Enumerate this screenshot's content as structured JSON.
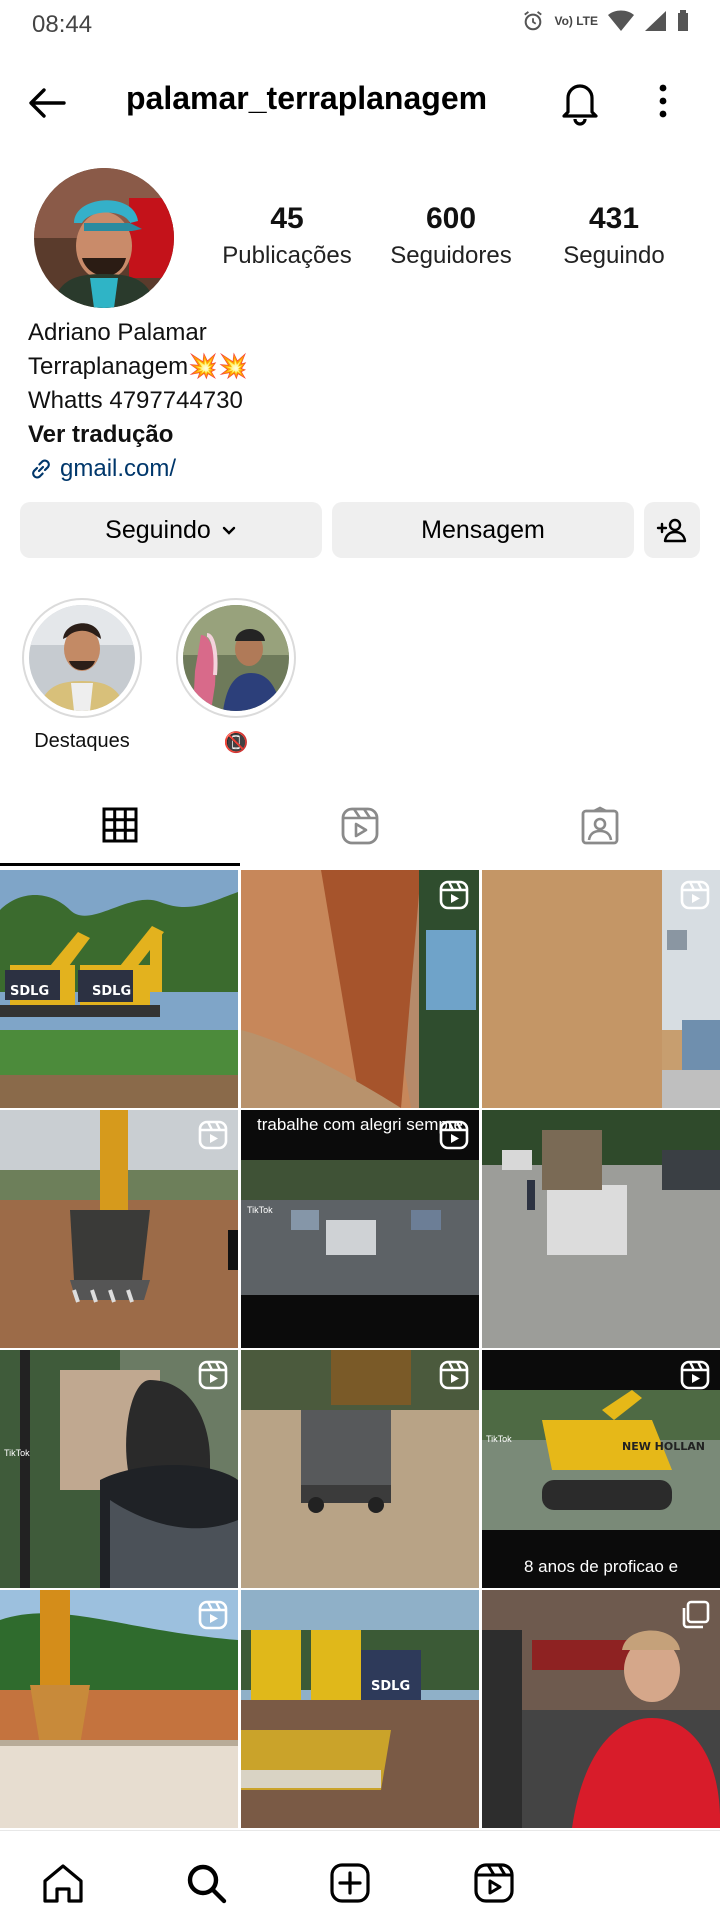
{
  "status": {
    "time": "08:44",
    "network_label": "Vo) LTE"
  },
  "header": {
    "username": "palamar_terraplanagem",
    "icons": [
      "back-arrow-icon",
      "bell-icon",
      "more-vertical-icon"
    ]
  },
  "profile": {
    "stats": [
      {
        "value": "45",
        "label": "Publicações"
      },
      {
        "value": "600",
        "label": "Seguidores"
      },
      {
        "value": "431",
        "label": "Seguindo"
      }
    ],
    "name": "Adriano Palamar",
    "bio_line1": "Terraplanagem💥💥",
    "bio_line2": "Whatts 4797744730",
    "translate": "Ver tradução",
    "link": "gmail.com/"
  },
  "actions": {
    "following_label": "Seguindo",
    "message_label": "Mensagem"
  },
  "highlights": [
    {
      "label": "Destaques"
    },
    {
      "label": "📵"
    }
  ],
  "tabs": [
    "grid-icon",
    "reels-icon",
    "tagged-icon"
  ],
  "grid": {
    "captions": {
      "top": "trabalhe com alegri sempre",
      "bottom": "8 anos de proficao e"
    },
    "tiktok_label": "TikTok"
  },
  "bottom_nav": [
    "home-icon",
    "search-icon",
    "create-icon",
    "reels-icon"
  ]
}
